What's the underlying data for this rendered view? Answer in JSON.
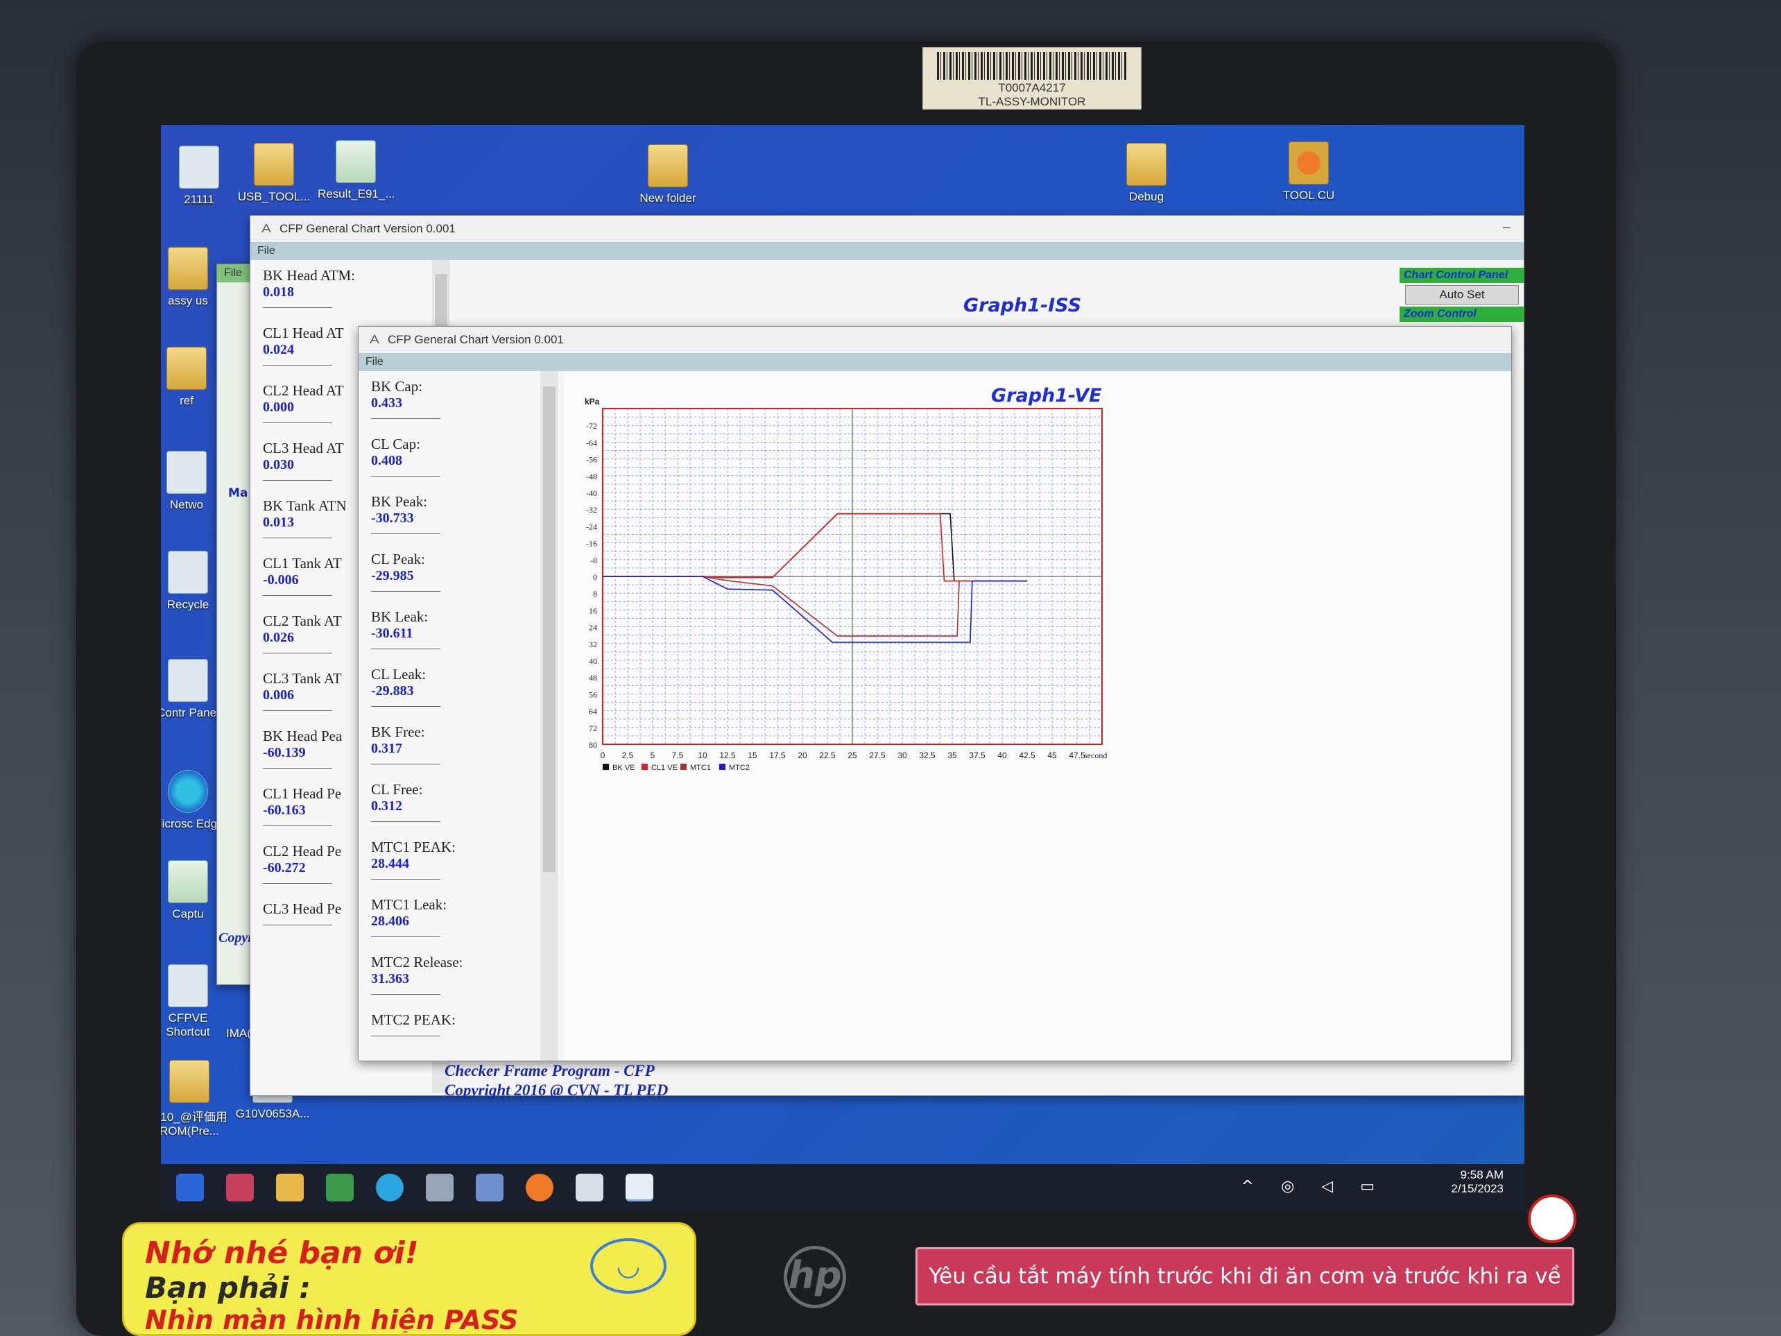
{
  "desktop_icons": [
    {
      "label": "21111"
    },
    {
      "label": "USB_TOOL..."
    },
    {
      "label": "Result_E91_..."
    },
    {
      "label": "New folder"
    },
    {
      "label": "Debug"
    },
    {
      "label": "TOOL CU"
    },
    {
      "label": "assy us"
    },
    {
      "label": "ref"
    },
    {
      "label": "Netwo"
    },
    {
      "label": "Recycle"
    },
    {
      "label": "Contr Panel"
    },
    {
      "label": "Microsc Edge"
    },
    {
      "label": "Captu"
    },
    {
      "label": "CFPVE Shortcut"
    },
    {
      "label": "IMA(KMK A..."
    },
    {
      "label": "G10_@评価用 ROM(Pre..."
    },
    {
      "label": "G10V0653A..."
    }
  ],
  "monitor": {
    "asset_tag": "T0007A4217",
    "asset_name": "TL-ASSY-MONITOR",
    "brand": "hp"
  },
  "window_iss": {
    "title": "CFP General Chart Version 0.001",
    "menu_file": "File",
    "graph_title": "Graph1-ISS",
    "measurements": [
      {
        "label": "BK Head ATM:",
        "value": "0.018"
      },
      {
        "label": "CL1 Head AT",
        "value": "0.024"
      },
      {
        "label": "CL2 Head AT",
        "value": "0.000"
      },
      {
        "label": "CL3 Head AT",
        "value": "0.030"
      },
      {
        "label": "BK Tank ATN",
        "value": "0.013"
      },
      {
        "label": "CL1 Tank AT",
        "value": "-0.006"
      },
      {
        "label": "CL2 Tank AT",
        "value": "0.026"
      },
      {
        "label": "CL3 Tank AT",
        "value": "0.006"
      },
      {
        "label": "BK Head Pea",
        "value": "-60.139"
      },
      {
        "label": "CL1 Head Pe",
        "value": "-60.163"
      },
      {
        "label": "CL2 Head Pe",
        "value": "-60.272"
      },
      {
        "label": "CL3 Head Pe",
        "value": ""
      }
    ],
    "chart_control": {
      "title": "Chart Control Panel",
      "auto_set": "Auto Set",
      "zoom_control": "Zoom Control"
    }
  },
  "window_back": {
    "menu_file": "File",
    "tab_label": "Ma",
    "copyright": "Copyright 2016"
  },
  "window_ve": {
    "title": "CFP General Chart Version 0.001",
    "menu_file": "File",
    "graph_title": "Graph1-VE",
    "measurements": [
      {
        "label": "BK Cap:",
        "value": "0.433"
      },
      {
        "label": "CL Cap:",
        "value": "0.408"
      },
      {
        "label": "BK Peak:",
        "value": "-30.733"
      },
      {
        "label": "CL Peak:",
        "value": "-29.985"
      },
      {
        "label": "BK Leak:",
        "value": "-30.611"
      },
      {
        "label": "CL Leak:",
        "value": "-29.883"
      },
      {
        "label": "BK Free:",
        "value": "0.317"
      },
      {
        "label": "CL Free:",
        "value": "0.312"
      },
      {
        "label": "MTC1 PEAK:",
        "value": "28.444"
      },
      {
        "label": "MTC1 Leak:",
        "value": "28.406"
      },
      {
        "label": "MTC2 Release:",
        "value": "31.363"
      },
      {
        "label": "MTC2 PEAK:",
        "value": ""
      }
    ]
  },
  "footer": {
    "line1": "Checker Frame Program - CFP",
    "line2": "Copyright 2016 @ CVN - TL PED"
  },
  "taskbar": {
    "time": "9:58 AM",
    "date": "2/15/2023"
  },
  "stickers": {
    "yellow_line1": "Nhớ nhé bạn ơi!",
    "yellow_line2": "Bạn phải :",
    "yellow_line3": "Nhìn màn hình hiện PASS",
    "red_notice": "Yêu cầu tắt máy tính trước khi đi ăn cơm và trước khi ra về"
  },
  "chart_data": {
    "type": "line",
    "title": "Graph1-VE",
    "ylabel": "kPa",
    "xlabel": "second",
    "x_ticks": [
      "0",
      "2.5",
      "5",
      "7.5",
      "10",
      "12.5",
      "15",
      "17.5",
      "20",
      "22.5",
      "25",
      "27.5",
      "30",
      "32.5",
      "35",
      "37.5",
      "40",
      "42.5",
      "45",
      "47.5"
    ],
    "y_ticks": [
      "-72",
      "-64",
      "-56",
      "-48",
      "-40",
      "-32",
      "-24",
      "-16",
      "-8",
      "0",
      "8",
      "16",
      "24",
      "32",
      "40",
      "48",
      "56",
      "64",
      "72",
      "80"
    ],
    "xlim": [
      0,
      50
    ],
    "ylim": [
      -80,
      80
    ],
    "y_inverted": true,
    "grid": true,
    "legend_position": "bottom-left",
    "series": [
      {
        "name": "BK VE",
        "color": "#111111",
        "x": [
          0,
          10,
          12,
          17,
          23.5,
          34.8,
          35.2,
          42.5
        ],
        "y": [
          0,
          0,
          0.5,
          0.5,
          -29.9,
          -29.9,
          2.2,
          2.2
        ]
      },
      {
        "name": "CL1 VE",
        "color": "#e02020",
        "x": [
          0,
          10,
          12,
          17,
          23.5,
          33.8,
          34.2,
          42.5
        ],
        "y": [
          0,
          0,
          0.5,
          0.5,
          -29.8,
          -29.8,
          2.2,
          2.2
        ]
      },
      {
        "name": "MTC1",
        "color": "#b03030",
        "x": [
          0,
          10,
          12.5,
          17,
          23.5,
          35.5,
          35.7,
          42.5
        ],
        "y": [
          0,
          0,
          2,
          4.5,
          28.4,
          28.4,
          2.2,
          2.2
        ]
      },
      {
        "name": "MTC2",
        "color": "#1a1ae0",
        "x": [
          0,
          10,
          12.5,
          17,
          23,
          36.8,
          37,
          42.5
        ],
        "y": [
          0,
          0,
          6,
          6.5,
          31.4,
          31.4,
          2.2,
          2.2
        ]
      }
    ]
  }
}
